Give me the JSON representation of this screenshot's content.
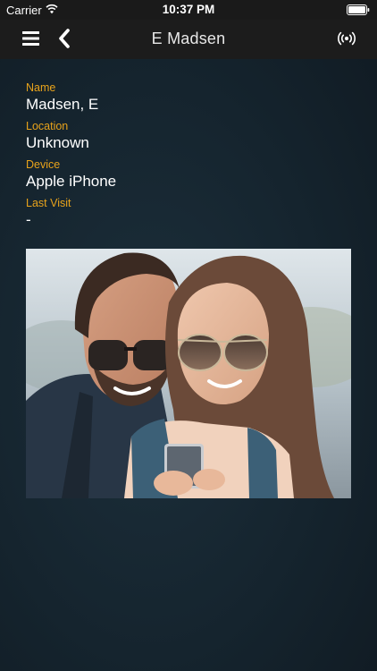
{
  "status_bar": {
    "carrier": "Carrier",
    "time": "10:37 PM"
  },
  "nav": {
    "title": "E Madsen",
    "left_icons": [
      "menu-icon",
      "back-icon"
    ],
    "right_icon": "broadcast-icon"
  },
  "fields": [
    {
      "label": "Name",
      "value": "Madsen, E"
    },
    {
      "label": "Location",
      "value": "Unknown"
    },
    {
      "label": "Device",
      "value": "Apple iPhone"
    },
    {
      "label": "Last Visit",
      "value": "-"
    }
  ],
  "colors": {
    "accent_label": "#e8a31b",
    "background": "#15242e",
    "nav_background": "#1c1c1c"
  }
}
